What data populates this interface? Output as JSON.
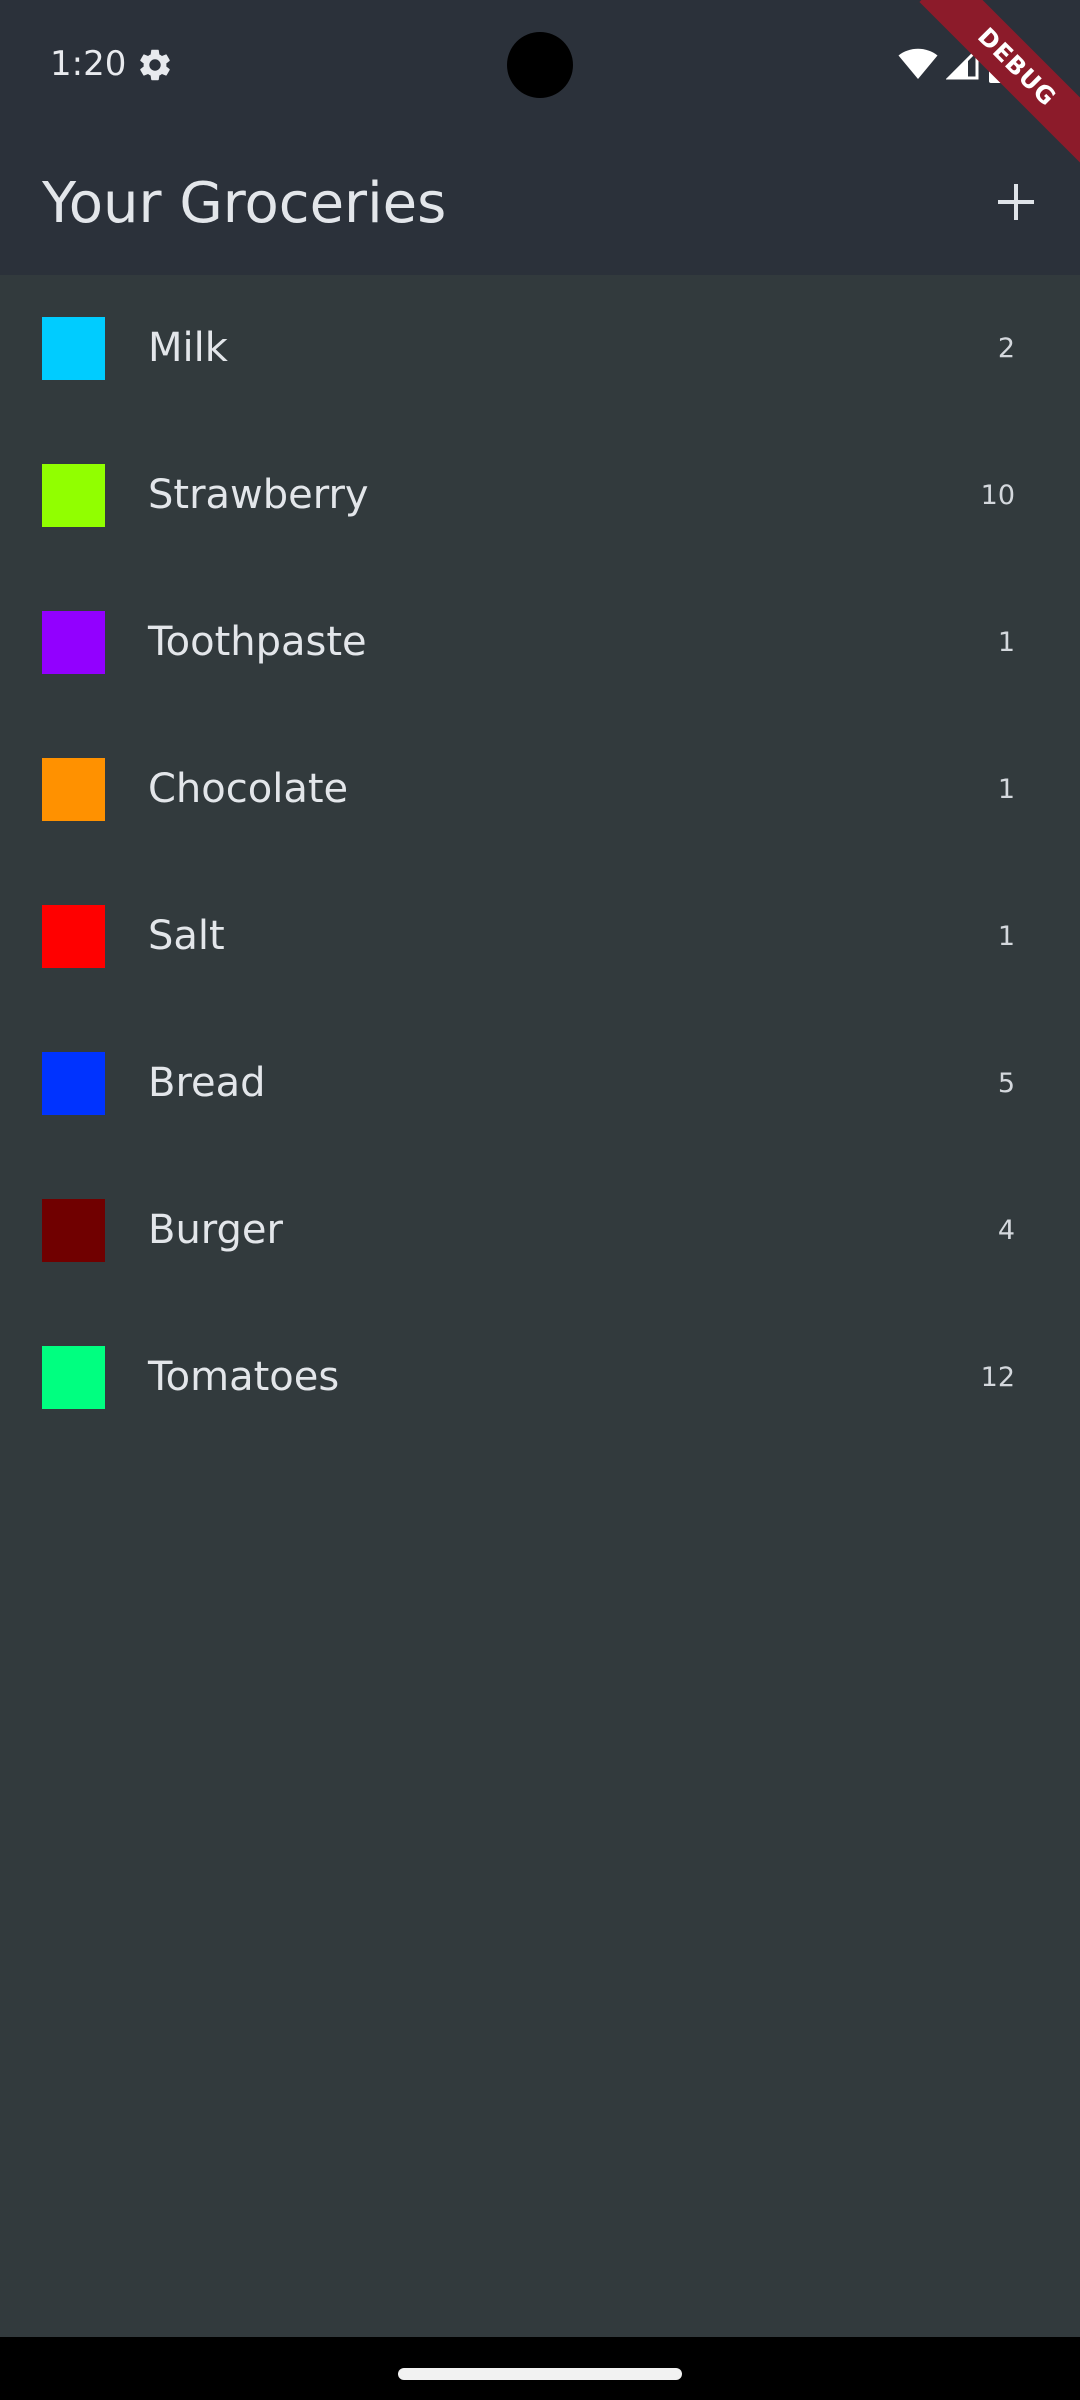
{
  "status_bar": {
    "time": "1:20",
    "icons": [
      "settings-gear-icon",
      "wifi-icon",
      "cellular-signal-icon",
      "battery-icon"
    ]
  },
  "debug_banner": "DEBUG",
  "app_bar": {
    "title": "Your Groceries",
    "action_icon": "plus-icon"
  },
  "groceries": [
    {
      "name": "Milk",
      "quantity": "2",
      "color": "#00ccff"
    },
    {
      "name": "Strawberry",
      "quantity": "10",
      "color": "#91ff00"
    },
    {
      "name": "Toothpaste",
      "quantity": "1",
      "color": "#9200ff"
    },
    {
      "name": "Chocolate",
      "quantity": "1",
      "color": "#ff9100"
    },
    {
      "name": "Salt",
      "quantity": "1",
      "color": "#ff0000"
    },
    {
      "name": "Bread",
      "quantity": "5",
      "color": "#0033ff"
    },
    {
      "name": "Burger",
      "quantity": "4",
      "color": "#700000"
    },
    {
      "name": "Tomatoes",
      "quantity": "12",
      "color": "#00ff80"
    }
  ],
  "colors": {
    "app_bar_background": "#2b313a",
    "list_background": "#323a3d",
    "text": "#e3e6ea",
    "debug_ribbon": "#8c1b2a"
  }
}
